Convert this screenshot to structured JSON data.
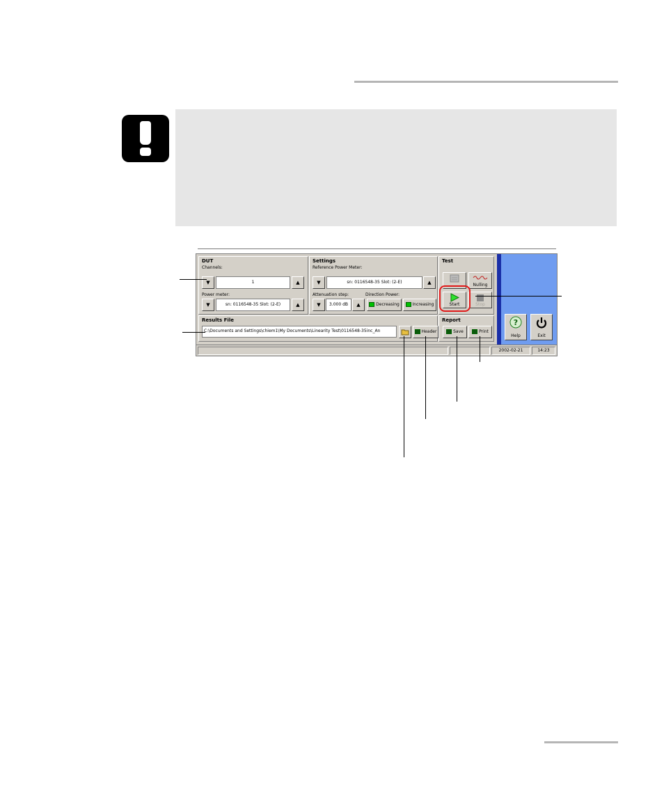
{
  "app": {
    "groups": {
      "dut": "DUT",
      "settings": "Settings",
      "test": "Test",
      "results_file": "Results File",
      "report": "Report"
    },
    "dut": {
      "channels_label": "Channels:",
      "channels_value": "1",
      "power_meter_label": "Power meter:",
      "power_meter_value": "sn: 0116548-35 Slot: (2-E)"
    },
    "settings": {
      "ref_label": "Reference Power Meter:",
      "ref_value": "sn: 0116548-35 Slot: (2-E)",
      "atten_label": "Attenuation step:",
      "atten_value": "3.000 dB",
      "direction_label": "Direction Power:",
      "decreasing": "Decreasing",
      "increasing": "Increasing"
    },
    "test": {
      "nulling": "Nulling",
      "start": "Start",
      "stop": "Stop"
    },
    "results": {
      "path": "C:\\Documents and Settings\\chiem1\\My Documents\\Linearity Test\\0116548-35inc_An",
      "header": "Header"
    },
    "report": {
      "save": "Save",
      "print": "Print"
    },
    "side": {
      "help": "Help",
      "exit": "Exit"
    },
    "status": {
      "date": "2002-02-21",
      "time": "14:23"
    }
  },
  "colors": {
    "side_panel": "#6f9cf0",
    "led_on": "#00c000",
    "highlight": "#e01818"
  }
}
